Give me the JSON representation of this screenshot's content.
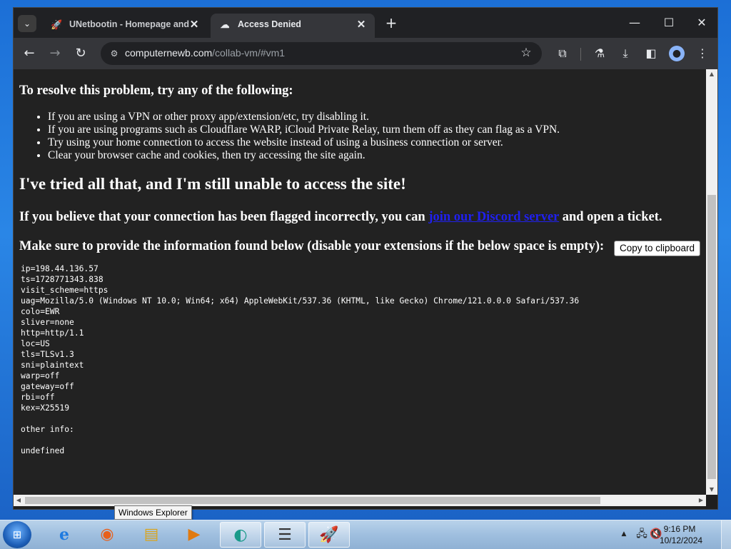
{
  "browser": {
    "tabs": [
      {
        "title": "UNetbootin - Homepage and Do",
        "icon": "rocket-icon",
        "active": false
      },
      {
        "title": "Access Denied",
        "icon": "cloud-shield-icon",
        "active": true
      }
    ],
    "new_tab_label": "+",
    "url": {
      "host": "computernewb.com",
      "path": "/collab-vm/#vm1"
    },
    "controls": {
      "minimize": "—",
      "maximize": "☐",
      "close": "✕"
    }
  },
  "page": {
    "resolve_heading": "To resolve this problem, try any of the following:",
    "tips": [
      "If you are using a VPN or other proxy app/extension/etc, try disabling it.",
      "If you are using programs such as Cloudflare WARP, iCloud Private Relay, turn them off as they can flag as a VPN.",
      "Try using your home connection to access the website instead of using a business connection or server.",
      "Clear your browser cache and cookies, then try accessing the site again."
    ],
    "tried_heading": "I've tried all that, and I'm still unable to access the site!",
    "flagged_prefix": "If you believe that your connection has been flagged incorrectly, you can",
    "discord_link": "join our Discord server",
    "flagged_suffix": "and open a ticket.",
    "provide_text": "Make sure to provide the information found below (disable your extensions if the below space is empty):",
    "copy_button": "Copy to clipboard",
    "info_lines": [
      "ip=198.44.136.57",
      "ts=1728771343.838",
      "visit_scheme=https",
      "uag=Mozilla/5.0 (Windows NT 10.0; Win64; x64) AppleWebKit/537.36 (KHTML, like Gecko) Chrome/121.0.0.0 Safari/537.36",
      "colo=EWR",
      "sliver=none",
      "http=http/1.1",
      "loc=US",
      "tls=TLSv1.3",
      "sni=plaintext",
      "warp=off",
      "gateway=off",
      "rbi=off",
      "kex=X25519",
      "",
      "other info:",
      "",
      "undefined"
    ]
  },
  "tooltip": "Windows Explorer",
  "taskbar": {
    "apps": [
      "internet-explorer-icon",
      "firefox-icon",
      "windows-explorer-icon",
      "media-player-icon",
      "collabvm-app-icon",
      "notepad-list-icon",
      "unetbootin-icon"
    ],
    "clock_time": "9:16 PM",
    "clock_date": "10/12/2024"
  }
}
